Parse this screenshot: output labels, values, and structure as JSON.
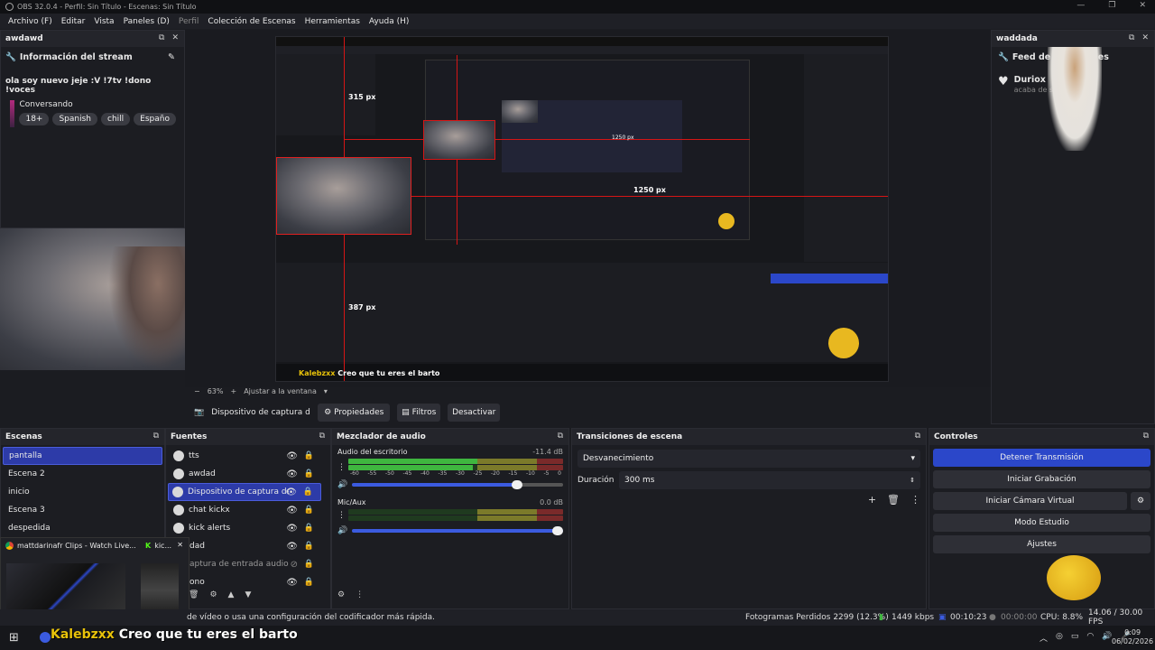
{
  "window": {
    "title": "OBS 32.0.4 - Perfil: Sin Título - Escenas: Sin Título"
  },
  "menu": [
    {
      "label": "Archivo (F)",
      "dim": false
    },
    {
      "label": "Editar",
      "dim": false
    },
    {
      "label": "Vista",
      "dim": false
    },
    {
      "label": "Paneles (D)",
      "dim": false
    },
    {
      "label": "Perfil",
      "dim": true
    },
    {
      "label": "Colección de Escenas",
      "dim": false
    },
    {
      "label": "Herramientas",
      "dim": false
    },
    {
      "label": "Ayuda (H)",
      "dim": false
    }
  ],
  "left_dock": {
    "title": "awdawd",
    "stream_info_title": "Información del stream",
    "stream_title": "ola soy nuevo jeje :V !7tv !dono !voces",
    "category": "Conversando",
    "tags": [
      "18+",
      "Spanish",
      "chill",
      "Españo"
    ]
  },
  "right_dock": {
    "title": "waddada",
    "feed_title": "Feed de actividades",
    "follower_name": "Duriox",
    "follower_action": "acaba de seguir"
  },
  "preview": {
    "zoom": "63%",
    "fit_label": "Ajustar a la ventana",
    "inner_labels": {
      "width_px": "1250 px",
      "height_px": "315 px",
      "other_px": "387 px",
      "chat_user": "Kalebzxx",
      "chat_msg": "Creo que tu eres el barto"
    }
  },
  "source_toolbar": {
    "source_name": "Dispositivo de captura de v",
    "properties": "Propiedades",
    "filters": "Filtros",
    "deactivate": "Desactivar"
  },
  "scenes": {
    "title": "Escenas",
    "items": [
      {
        "label": "pantalla",
        "selected": true
      },
      {
        "label": "Escena 2",
        "selected": false
      },
      {
        "label": "inicio",
        "selected": false
      },
      {
        "label": "Escena 3",
        "selected": false
      },
      {
        "label": "despedida",
        "selected": false
      }
    ]
  },
  "sources": {
    "title": "Fuentes",
    "items": [
      {
        "label": "tts",
        "selected": false
      },
      {
        "label": "awdad",
        "selected": false
      },
      {
        "label": "Dispositivo de captura de vío",
        "selected": true
      },
      {
        "label": "chat kickx",
        "selected": false
      },
      {
        "label": "kick alerts",
        "selected": false
      },
      {
        "label": "dad",
        "selected": false
      },
      {
        "label": "aptura de entrada audio",
        "selected": false
      },
      {
        "label": "ono",
        "selected": false
      }
    ]
  },
  "audio_mixer": {
    "title": "Mezclador de audio",
    "channels": [
      {
        "name": "Audio del escritorio",
        "db": "-11.4 dB",
        "level": 0.55,
        "volume": 0.78
      },
      {
        "name": "Mic/Aux",
        "db": "0.0 dB",
        "level": 0.0,
        "volume": 1.0
      }
    ],
    "ticks": [
      "-60",
      "-55",
      "-50",
      "-45",
      "-40",
      "-35",
      "-30",
      "-25",
      "-20",
      "-15",
      "-10",
      "-5",
      "0"
    ]
  },
  "transitions": {
    "title": "Transiciones de escena",
    "selected": "Desvanecimiento",
    "duration_label": "Duración",
    "duration_value": "300 ms"
  },
  "controls": {
    "title": "Controles",
    "buttons": [
      "Detener Transmisión",
      "Iniciar Grabación",
      "Iniciar Cámara Virtual",
      "Modo Estudio",
      "Ajustes"
    ]
  },
  "taskbar_popup": {
    "window1": "mattdarinafr Clips - Watch Live...",
    "window2": "kic..."
  },
  "status": {
    "message": "de vídeo o usa una configuración del codificador más rápida.",
    "dropped_frames": "Fotogramas Perdidos 2299 (12.3%)",
    "bitrate": "1449 kbps",
    "stream_time": "00:10:23",
    "rec_time": "00:00:00",
    "cpu": "CPU: 8.8%",
    "fps": "14.06 / 30.00 FPS"
  },
  "overlay_chat": {
    "user": "Kalebzxx",
    "message": "Creo que tu eres el barto"
  },
  "clock": {
    "time": "0:09",
    "date": "06/02/2026"
  },
  "colors": {
    "accent": "#2b47c9",
    "selection": "#2d3ba8",
    "red_guide": "#d51515",
    "meter_green": "#3fb63f"
  }
}
